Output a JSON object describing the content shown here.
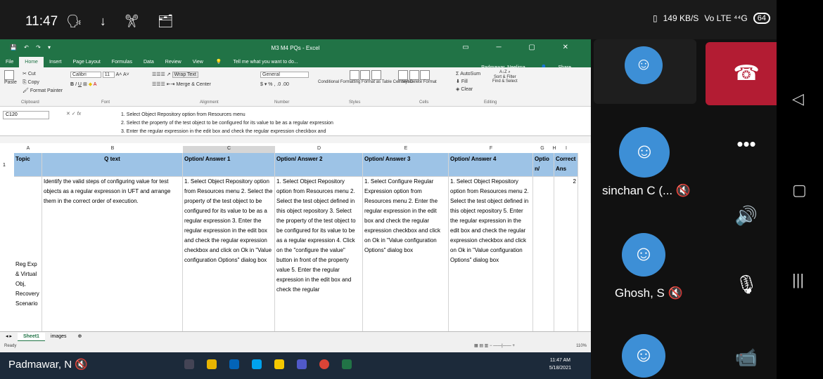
{
  "phone_status": {
    "time": "11:47",
    "icons": "🗣 ↓ ✂ 🗂",
    "speed": "149 KB/S",
    "network": "Vo LTE ⁴⁴G",
    "battery": "64"
  },
  "excel": {
    "title": "M3 M4 PQs - Excel",
    "quick_access": "💾 ↶ ↷ ▾",
    "window_controls": "▭ ─ ▢ ✕",
    "tabs": [
      "File",
      "Home",
      "Insert",
      "Page Layout",
      "Formulas",
      "Data",
      "Review",
      "View"
    ],
    "tell_me": "Tell me what you want to do...",
    "user": "Padmawar, Neelima",
    "share": "Share",
    "ribbon": {
      "clipboard": {
        "paste": "Paste",
        "cut": "Cut",
        "copy": "Copy",
        "format_painter": "Format Painter",
        "label": "Clipboard"
      },
      "font": {
        "name": "Calibri",
        "size": "11",
        "label": "Font"
      },
      "alignment": {
        "wrap": "Wrap Text",
        "merge": "Merge & Center",
        "label": "Alignment"
      },
      "number": {
        "format": "General",
        "label": "Number"
      },
      "styles": {
        "cond": "Conditional Formatting",
        "table": "Format as Table",
        "cell": "Cell Styles",
        "label": "Styles"
      },
      "cells": {
        "insert": "Insert",
        "delete": "Delete",
        "format": "Format",
        "label": "Cells"
      },
      "editing": {
        "autosum": "AutoSum",
        "fill": "Fill",
        "clear": "Clear",
        "sort": "Sort & Filter",
        "find": "Find & Select",
        "label": "Editing"
      }
    },
    "name_box": "C120",
    "formula_lines": [
      "1. Select Object Repository option from Resources menu",
      "2. Select the property of the test object to be configured for its value to be as a regular expression",
      "3. Enter the regular expression in the edit box and check the regular expression checkbox and"
    ],
    "columns": [
      "A",
      "B",
      "C",
      "D",
      "E",
      "F",
      "G",
      "H",
      "I"
    ],
    "row_numbers": [
      "1"
    ],
    "headers": [
      "Topic",
      "Q text",
      "Option/ Answer 1",
      "Option/ Answer 2",
      "Option/ Answer 3",
      "Option/ Answer 4",
      "Optio n/",
      "Correct Ans"
    ],
    "row": {
      "topic": "Reg Exp & Virtual Obj, Recovery Scenario",
      "q": "Identify the valid steps of configuring value for test objects as a regular expresson in UFT and arrange them in the correct order of execution.",
      "a1": "1. Select Object Repository option from Resources menu 2. Select the property of the test object to be configured for its value to be as a regular expression 3. Enter the regular expression in the edit box and check the regular expression checkbox and click on Ok in \"Value configuration Options\" dialog box",
      "a2": "1. Select Object Repository option from Resources menu 2. Select the test object defined in this object repository 3. Select the property of the test object to be configured for its value to be as a regular expression 4. Click on the \"configure the value\" button in front of the property value 5. Enter the regular expression in the edit box and check the regular",
      "a3": "1. Select Configure Regular Expression option from Resources menu 2. Enter the regular expression in the edit box and check the regular expression checkbox and click on Ok in \"Value configuration Options\" dialog box",
      "a4": "1. Select Object Repository option from Resources menu 2. Select the test object defined in this object repository 5. Enter the regular expression in the edit box and check the regular expression checkbox and click on Ok in \"Value configuration Options\" dialog box",
      "correct": "2"
    },
    "sheets": [
      "Sheet1",
      "images"
    ],
    "status": "Ready",
    "zoom": "110%",
    "clock_time": "11:47 AM",
    "clock_date": "5/18/2021"
  },
  "presenter": "Padmawar, N",
  "call": {
    "participants": [
      {
        "name": "sinchan C (..."
      },
      {
        "name": "Ghosh, S"
      }
    ]
  },
  "colors": {
    "excel_green": "#217346",
    "header_blue": "#9dc3e6",
    "hangup": "#b31c33",
    "avatar": "#3d8fd6"
  }
}
